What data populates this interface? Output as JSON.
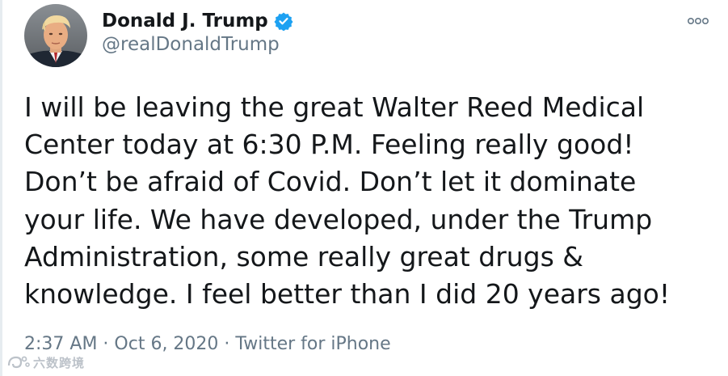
{
  "author": {
    "name": "Donald J. Trump",
    "handle": "@realDonaldTrump",
    "verified": true,
    "verified_color": "#1da1f2"
  },
  "tweet": {
    "text": "I will be leaving the great Walter Reed Medical\nCenter today at 6:30 P.M. Feeling really good!\nDon’t be afraid of Covid. Don’t let it dominate\nyour life. We have developed, under the Trump\nAdministration, some really great drugs &\nknowledge. I feel better than I did 20 years ago!"
  },
  "meta": {
    "time": "2:37 AM",
    "separator": " · ",
    "date": "Oct 6, 2020",
    "source": "Twitter for iPhone"
  },
  "icons": {
    "more": "more-options-icon",
    "verified": "verified-badge-icon",
    "watermark": "watermark-logo-icon"
  },
  "watermark": {
    "text": "六数跨境"
  }
}
